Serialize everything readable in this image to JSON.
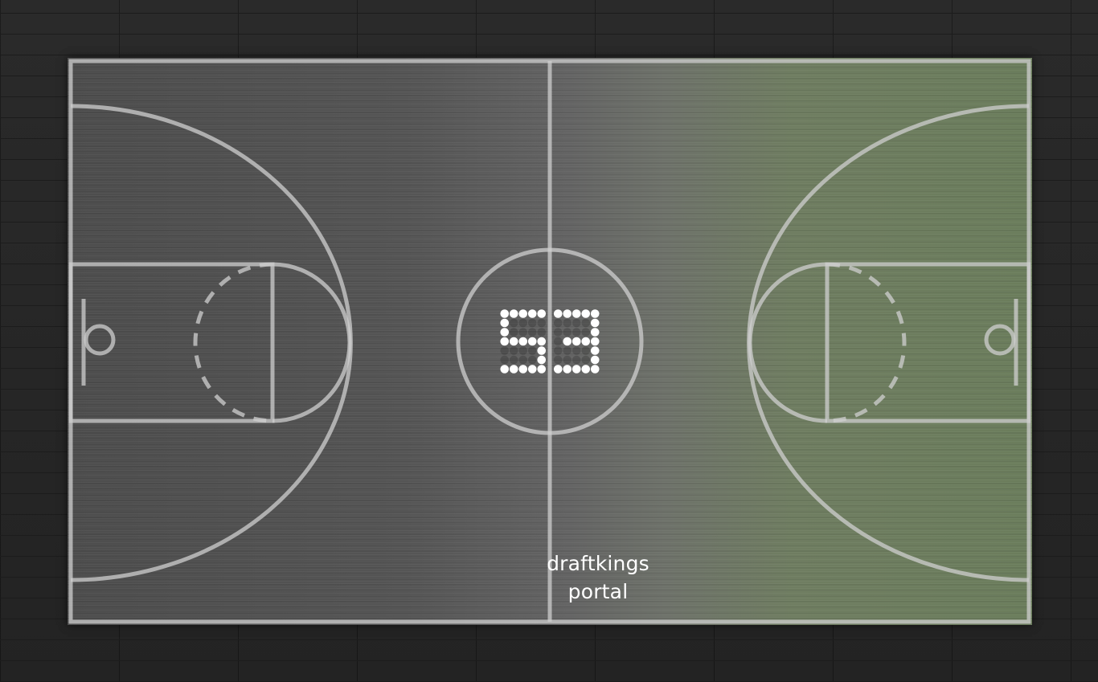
{
  "scoreboard": {
    "value": "53",
    "digit_color": "#ffffff"
  },
  "brand": {
    "line1": "draftkings",
    "line2": "portal"
  },
  "colors": {
    "wall": "#262626",
    "court_left": "#4d4d4d",
    "court_right": "#6b7d5c",
    "lines": "#c8c8c8"
  }
}
